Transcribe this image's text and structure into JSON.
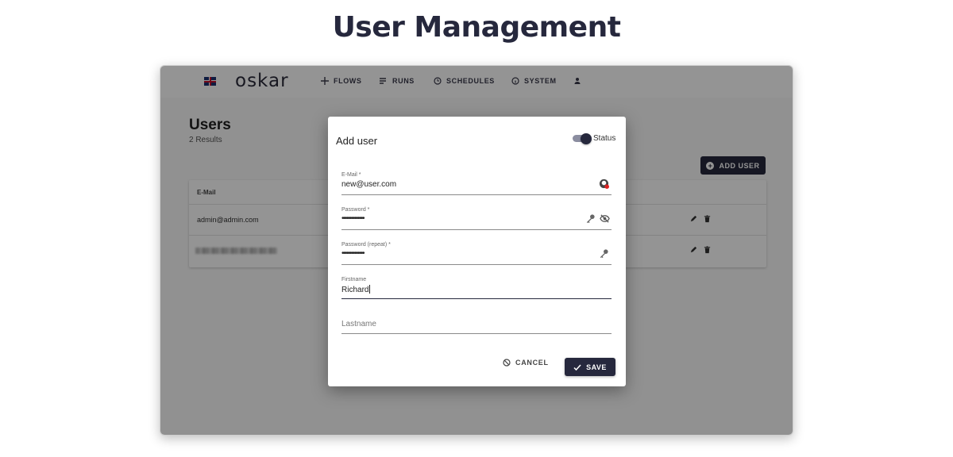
{
  "page": {
    "heading": "User Management"
  },
  "topbar": {
    "language_icon": "uk-flag-icon",
    "logo": "oskar",
    "nav": [
      {
        "label": "FLOWS",
        "icon": "flows-icon"
      },
      {
        "label": "RUNS",
        "icon": "runs-icon"
      },
      {
        "label": "SCHEDULES",
        "icon": "clock-icon"
      },
      {
        "label": "SYSTEM",
        "icon": "info-icon"
      },
      {
        "label": "",
        "icon": "person-icon"
      }
    ]
  },
  "users_page": {
    "title": "Users",
    "results": "2 Results",
    "add_user_label": "ADD USER",
    "table": {
      "columns": [
        "E-Mail"
      ],
      "rows": [
        {
          "email": "admin@admin.com"
        },
        {
          "email": ""
        }
      ]
    }
  },
  "dialog": {
    "title": "Add user",
    "status_label": "Status",
    "status_on": true,
    "fields": {
      "email": {
        "label": "E-Mail *",
        "value": "new@user.com"
      },
      "password": {
        "label": "Password *",
        "value": "••••••••••••••"
      },
      "password_repeat": {
        "label": "Password (repeat) *",
        "value": "••••••••••••••"
      },
      "firstname": {
        "label": "Firstname",
        "value": "Richard"
      },
      "lastname": {
        "placeholder": "Lastname"
      }
    },
    "cancel_label": "CANCEL",
    "save_label": "SAVE"
  },
  "colors": {
    "primary": "#26283d",
    "overlay": "rgba(0,0,0,0.42)"
  }
}
